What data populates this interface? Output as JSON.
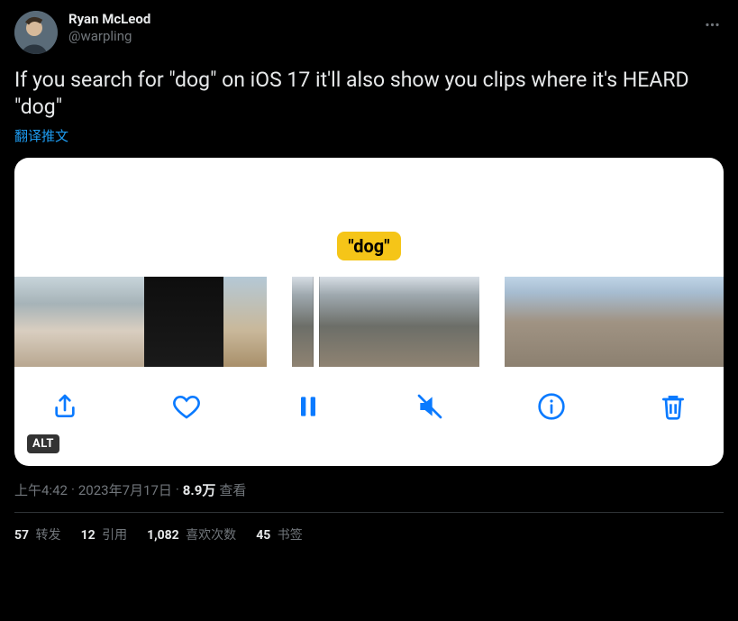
{
  "author": {
    "display_name": "Ryan McLeod",
    "handle": "@warpling"
  },
  "tweet_text": "If you search for \"dog\" on iOS 17 it'll also show you clips where it's HEARD \"dog\"",
  "translate_label": "翻译推文",
  "media": {
    "search_tag": "\"dog\"",
    "alt_badge": "ALT",
    "toolbar_icons": [
      "share",
      "heart",
      "pause",
      "mute",
      "info",
      "trash"
    ]
  },
  "meta": {
    "time": "上午4:42",
    "dot1": " · ",
    "date": "2023年7月17日",
    "dot2": " · ",
    "views_count": "8.9万",
    "views_label": " 查看"
  },
  "stats": {
    "retweets": {
      "count": "57",
      "label": " 转发"
    },
    "quotes": {
      "count": "12",
      "label": " 引用"
    },
    "likes": {
      "count": "1,082",
      "label": " 喜欢次数"
    },
    "bookmarks": {
      "count": "45",
      "label": " 书签"
    }
  }
}
